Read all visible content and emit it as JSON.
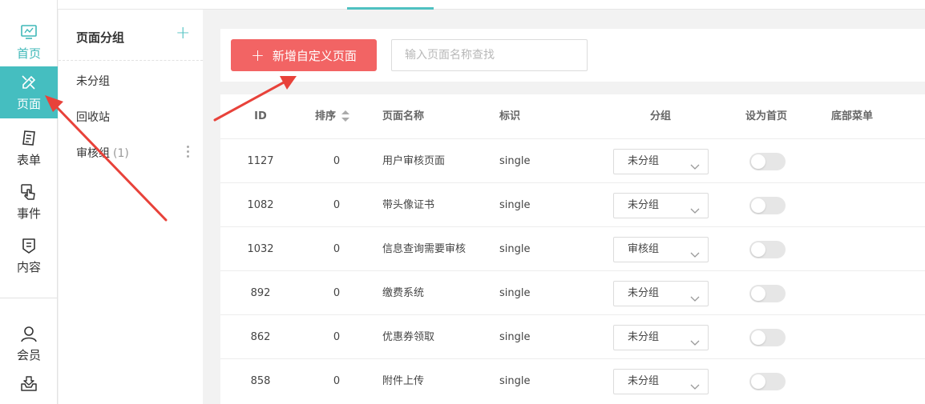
{
  "nav": {
    "items": [
      {
        "label": "首页",
        "icon": "monitor-icon",
        "state": "teal"
      },
      {
        "label": "页面",
        "icon": "pencil-ruler-icon",
        "state": "active"
      },
      {
        "label": "表单",
        "icon": "clipboard-icon",
        "state": "normal"
      },
      {
        "label": "事件",
        "icon": "hand-pointer-icon",
        "state": "normal"
      },
      {
        "label": "内容",
        "icon": "content-shield-icon",
        "state": "normal"
      },
      {
        "label": "会员",
        "icon": "user-icon",
        "state": "normal"
      },
      {
        "label": "",
        "icon": "inbox-download-icon",
        "state": "normal"
      }
    ]
  },
  "groups": {
    "title": "页面分组",
    "items": [
      {
        "label": "未分组"
      },
      {
        "label": "回收站"
      },
      {
        "label": "审核组",
        "count": "(1)"
      }
    ]
  },
  "toolbar": {
    "new_button_label": "新增自定义页面",
    "search_placeholder": "输入页面名称查找"
  },
  "table": {
    "headers": {
      "id": "ID",
      "order": "排序",
      "name": "页面名称",
      "flag": "标识",
      "group": "分组",
      "homepage": "设为首页",
      "bottom_menu": "底部菜单"
    },
    "rows": [
      {
        "id": "1127",
        "order": "0",
        "name": "用户审核页面",
        "flag": "single",
        "group": "未分组",
        "homepage": false
      },
      {
        "id": "1082",
        "order": "0",
        "name": "带头像证书",
        "flag": "single",
        "group": "未分组",
        "homepage": false
      },
      {
        "id": "1032",
        "order": "0",
        "name": "信息查询需要审核",
        "flag": "single",
        "group": "审核组",
        "homepage": false
      },
      {
        "id": "892",
        "order": "0",
        "name": "缴费系统",
        "flag": "single",
        "group": "未分组",
        "homepage": false
      },
      {
        "id": "862",
        "order": "0",
        "name": "优惠券领取",
        "flag": "single",
        "group": "未分组",
        "homepage": false
      },
      {
        "id": "858",
        "order": "0",
        "name": "附件上传",
        "flag": "single",
        "group": "未分组",
        "homepage": false
      }
    ]
  },
  "colors": {
    "accent": "#45bec0",
    "primary_button": "#f26464",
    "annotation_arrow": "#e8423a"
  }
}
